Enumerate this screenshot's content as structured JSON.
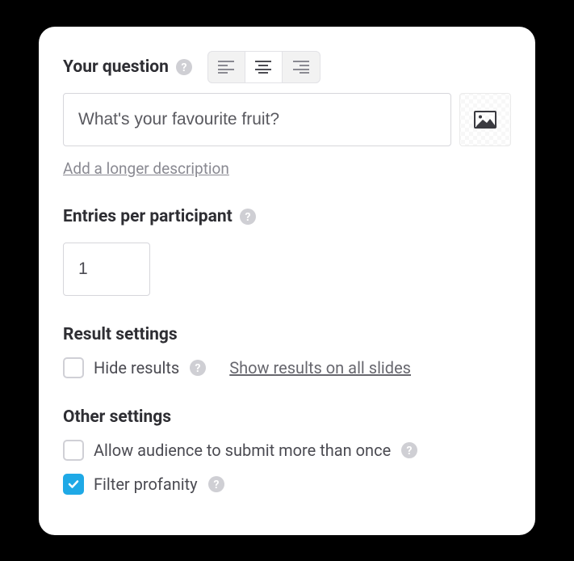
{
  "question": {
    "label": "Your question",
    "value": "What's your favourite fruit?",
    "descriptionLink": "Add a longer description",
    "alignment": "center"
  },
  "entries": {
    "label": "Entries per participant",
    "value": "1"
  },
  "resultSettings": {
    "label": "Result settings",
    "hideResults": {
      "label": "Hide results",
      "checked": false
    },
    "showAllSlidesLink": "Show results on all slides"
  },
  "otherSettings": {
    "label": "Other settings",
    "allowMultiple": {
      "label": "Allow audience to submit more than once",
      "checked": false
    },
    "filterProfanity": {
      "label": "Filter profanity",
      "checked": true
    }
  }
}
